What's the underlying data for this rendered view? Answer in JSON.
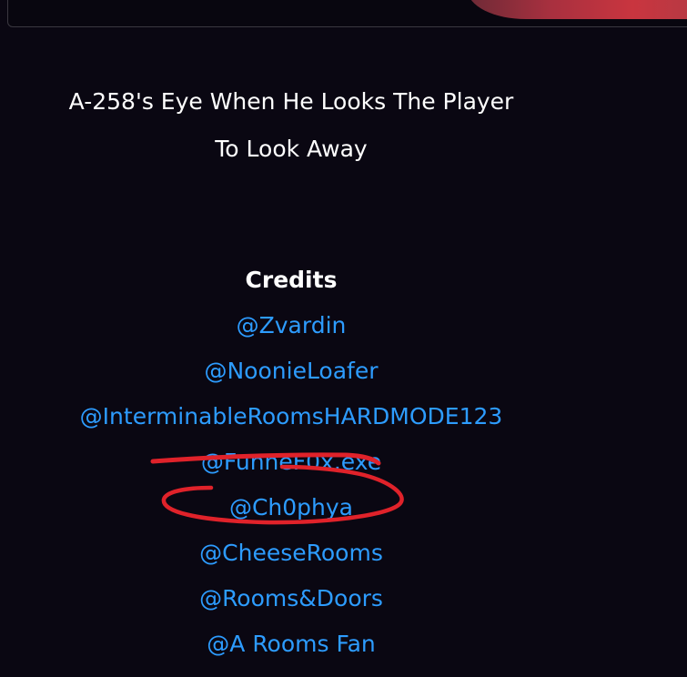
{
  "post": {
    "caption_line1": "A-258's Eye When He Looks The Player",
    "caption_line2": "To Look Away"
  },
  "credits": {
    "title": "Credits",
    "items": [
      {
        "handle": "@Zvardin"
      },
      {
        "handle": "@NoonieLoafer"
      },
      {
        "handle": "@InterminableRoomsHARDMODE123"
      },
      {
        "handle": "@FunneF0x.exe"
      },
      {
        "handle": "@Ch0phya"
      },
      {
        "handle": "@CheeseRooms"
      },
      {
        "handle": "@Rooms&Doors"
      },
      {
        "handle": "@A Rooms Fan"
      }
    ]
  },
  "colors": {
    "background": "#0a0712",
    "link": "#2d9cff",
    "annotation": "#e0222a"
  }
}
